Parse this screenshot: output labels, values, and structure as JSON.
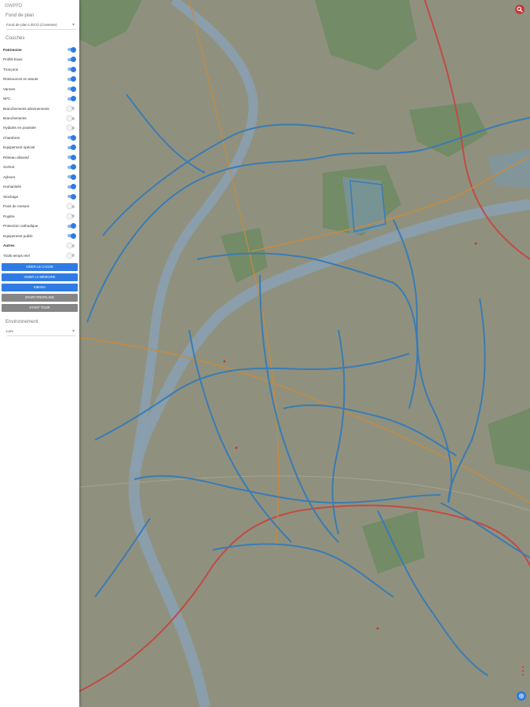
{
  "app": {
    "title": "GWPFD"
  },
  "basemap": {
    "heading": "Fond de plan",
    "selected": "Fond de plan LISCO (Contexte)"
  },
  "layers": {
    "heading": "Couches",
    "items": [
      {
        "label": "Patrimoine",
        "on": true,
        "bold": true
      },
      {
        "label": "Profils Eaux",
        "on": true,
        "bold": false
      },
      {
        "label": "Tronçons",
        "on": true,
        "bold": false
      },
      {
        "label": "Ressources en atouts",
        "on": true,
        "bold": false
      },
      {
        "label": "Vannes",
        "on": true,
        "bold": false
      },
      {
        "label": "NFC",
        "on": true,
        "bold": false
      },
      {
        "label": "Branchements abonnements",
        "on": false,
        "bold": false
      },
      {
        "label": "Branchements",
        "on": false,
        "bold": false
      },
      {
        "label": "Hydants en poussée",
        "on": false,
        "bold": false
      },
      {
        "label": "Chambres",
        "on": true,
        "bold": false
      },
      {
        "label": "Equipement spécial",
        "on": true,
        "bold": false
      },
      {
        "label": "Réseau allowed",
        "on": true,
        "bold": false
      },
      {
        "label": "Scénot",
        "on": true,
        "bold": false
      },
      {
        "label": "Ayleurs",
        "on": true,
        "bold": false
      },
      {
        "label": "Humanisés",
        "on": true,
        "bold": false
      },
      {
        "label": "Stockage",
        "on": true,
        "bold": false
      },
      {
        "label": "Point de mesure",
        "on": false,
        "bold": false
      },
      {
        "label": "Pupitre",
        "on": false,
        "bold": false
      },
      {
        "label": "Protection cathodique",
        "on": true,
        "bold": false
      },
      {
        "label": "Equipement public",
        "on": true,
        "bold": false
      },
      {
        "label": "Autres",
        "on": false,
        "bold": true
      },
      {
        "label": "Trails temps réel",
        "on": false,
        "bold": false
      }
    ]
  },
  "buttons": [
    {
      "label": "VIDER LE CACHE",
      "style": "blue"
    },
    {
      "label": "VIDER LA MÉMOIRE",
      "style": "blue"
    },
    {
      "label": "KIBANA",
      "style": "blue"
    },
    {
      "label": "START PROFILING",
      "style": "gray"
    },
    {
      "label": "START TOUR",
      "style": "gray"
    }
  ],
  "environment": {
    "heading": "Environnement",
    "selected": "Lum"
  },
  "icons": {
    "search": "search-icon",
    "location": "location-icon",
    "more": "more-vert-icon"
  },
  "colors": {
    "accent": "#2f7be3",
    "network": "#3a7bb5",
    "search_fab": "#c23a3a"
  }
}
